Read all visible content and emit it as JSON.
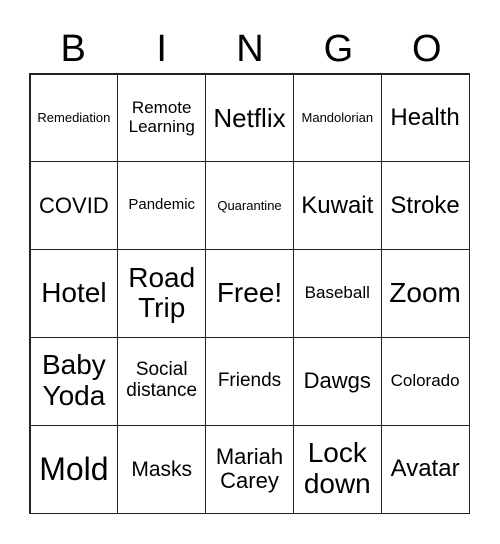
{
  "header": [
    "B",
    "I",
    "N",
    "G",
    "O"
  ],
  "cells": [
    [
      "Remediation",
      "Remote Learning",
      "Netflix",
      "Mandolorian",
      "Health"
    ],
    [
      "COVID",
      "Pandemic",
      "Quarantine",
      "Kuwait",
      "Stroke"
    ],
    [
      "Hotel",
      "Road Trip",
      "Free!",
      "Baseball",
      "Zoom"
    ],
    [
      "Baby Yoda",
      "Social distance",
      "Friends",
      "Dawgs",
      "Colorado"
    ],
    [
      "Mold",
      "Masks",
      "Mariah Carey",
      "Lock down",
      "Avatar"
    ]
  ]
}
